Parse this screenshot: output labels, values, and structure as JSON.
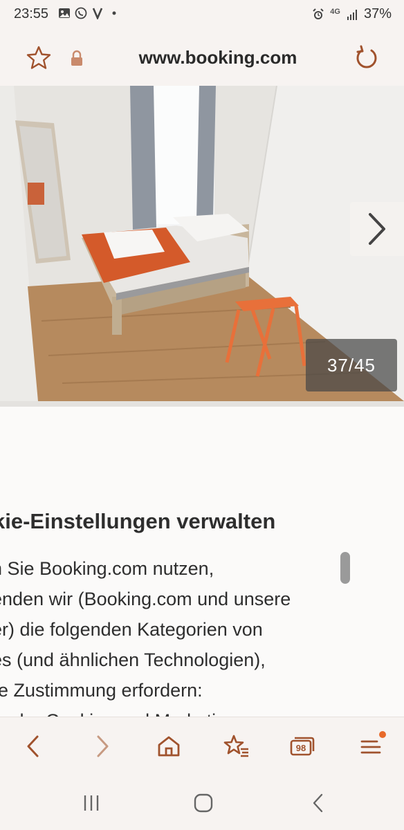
{
  "status_bar": {
    "time": "23:55",
    "network": "4G",
    "battery": "37%"
  },
  "browser": {
    "url": "www.booking.com"
  },
  "gallery": {
    "counter": "37/45"
  },
  "content": {
    "heading": "kie-Einstellungen verwalten",
    "body_lines": [
      "n Sie Booking.com nutzen,",
      "enden wir (Booking.com und unsere",
      "er) die folgenden Kategorien von",
      "es (und ähnlichen Technologien),",
      "re Zustimmung erfordern:",
      "tische Cookies und Marketing-"
    ]
  },
  "toolbar": {
    "tabs_count": "98"
  },
  "colors": {
    "accent": "#a0522d",
    "notification_dot": "#e8692a"
  }
}
